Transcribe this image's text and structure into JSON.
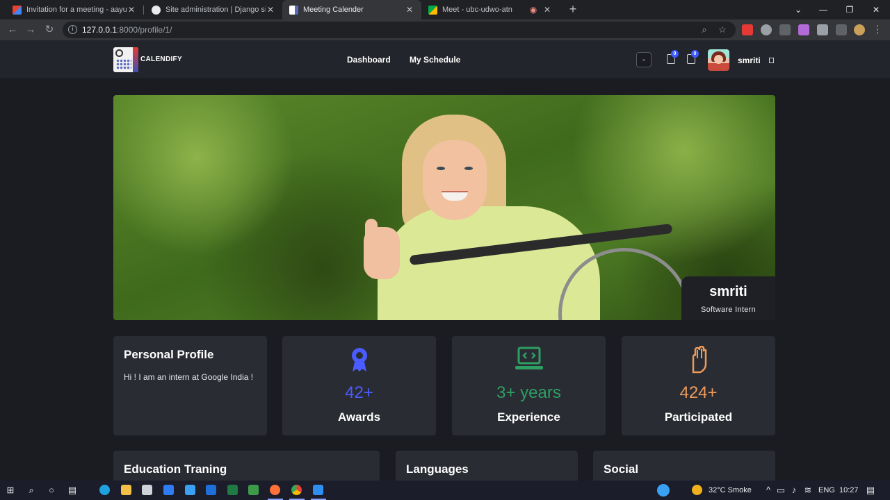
{
  "browser": {
    "tabs": [
      {
        "title": "Invitation for a meeting - aayush",
        "favicon": "gmail-icon"
      },
      {
        "title": "Site administration | Django site",
        "favicon": "globe-icon"
      },
      {
        "title": "Meeting Calender",
        "favicon": "calendar-icon"
      },
      {
        "title": "Meet - ubc-udwo-atn",
        "favicon": "meet-icon"
      }
    ],
    "active_tab": 2,
    "url_host": "127.0.0.1",
    "url_rest": ":8000/profile/1/"
  },
  "navbar": {
    "brand": "CALENDIFY",
    "links": [
      "Dashboard",
      "My Schedule"
    ],
    "badge_1": "0",
    "badge_2": "0",
    "username": "smriti"
  },
  "hero": {
    "name": "smriti",
    "role": "Software Intern"
  },
  "profile_card": {
    "title": "Personal Profile",
    "text": "Hi ! I am an intern at Google India !"
  },
  "stats": [
    {
      "value": "42+",
      "label": "Awards",
      "color": "#4a5cff",
      "icon": "award-icon"
    },
    {
      "value": "3+ years",
      "label": "Experience",
      "color": "#2e9e63",
      "icon": "laptop-code-icon"
    },
    {
      "value": "424+",
      "label": "Participated",
      "color": "#ec9a5a",
      "icon": "raised-hand-icon"
    }
  ],
  "sections": [
    "Education Traning",
    "Languages",
    "Social"
  ],
  "taskbar": {
    "weather": "32°C  Smoke",
    "lang": "ENG",
    "time": "10:27"
  }
}
